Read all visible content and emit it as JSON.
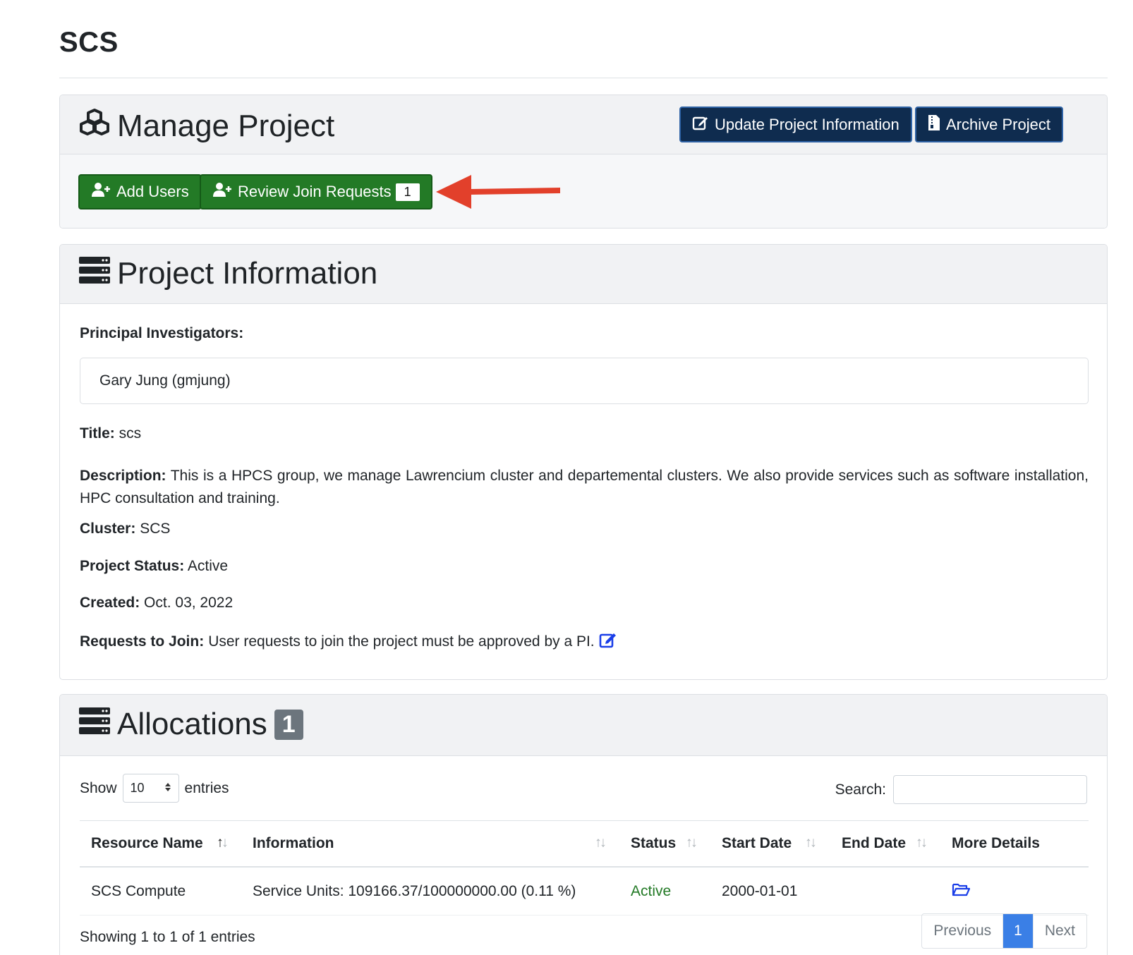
{
  "page": {
    "title": "SCS"
  },
  "manage": {
    "title": "Manage Project",
    "update_label": "Update Project Information",
    "archive_label": "Archive Project",
    "add_users_label": "Add Users",
    "review_label": "Review Join Requests",
    "review_count": "1"
  },
  "info": {
    "title": "Project Information",
    "pi_label": "Principal Investigators:",
    "pi_value": "Gary Jung (gmjung)",
    "title_label": "Title:",
    "title_value": "scs",
    "desc_label": "Description:",
    "desc_value": "This is a HPCS group, we manage Lawrencium cluster and departemental clusters. We also provide services such as software installation, HPC consultation and training.",
    "cluster_label": "Cluster:",
    "cluster_value": "SCS",
    "status_label": "Project Status:",
    "status_value": "Active",
    "created_label": "Created:",
    "created_value": "Oct. 03, 2022",
    "join_label": "Requests to Join:",
    "join_value": "User requests to join the project must be approved by a PI."
  },
  "allocations": {
    "title": "Allocations",
    "count": "1",
    "show_label": "Show",
    "page_size": "10",
    "entries_label": "entries",
    "search_label": "Search:",
    "columns": [
      "Resource Name",
      "Information",
      "Status",
      "Start Date",
      "End Date",
      "More Details"
    ],
    "rows": [
      {
        "resource": "SCS Compute",
        "information": "Service Units: 109166.37/100000000.00 (0.11 %)",
        "status": "Active",
        "start": "2000-01-01",
        "end": ""
      }
    ],
    "showing_text": "Showing 1 to 1 of 1 entries",
    "pager": {
      "previous": "Previous",
      "current": "1",
      "next": "Next"
    }
  },
  "colors": {
    "primary_dark": "#0f2c4f",
    "success": "#237a26",
    "link": "#1a3ee8",
    "annotation_arrow": "#e2402b"
  }
}
